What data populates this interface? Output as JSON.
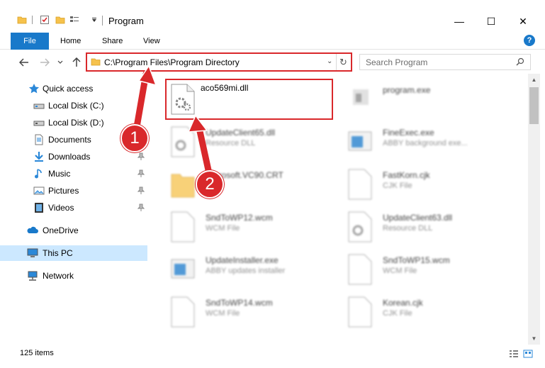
{
  "window": {
    "title": "Program",
    "minimize": "—",
    "maximize": "☐",
    "close": "✕"
  },
  "ribbon": {
    "tabs": [
      "File",
      "Home",
      "Share",
      "View"
    ],
    "help": "?"
  },
  "address": {
    "path": "C:\\Program Files\\Program Directory",
    "chevron": "⌄",
    "refresh": "↻"
  },
  "search": {
    "placeholder": "Search Program"
  },
  "sidebar": {
    "items": [
      {
        "label": "Quick access",
        "icon": "star-icon",
        "pinned": false
      },
      {
        "label": "Local Disk (C:)",
        "icon": "drive-icon",
        "pinned": false
      },
      {
        "label": "Local Disk (D:)",
        "icon": "drive-icon",
        "pinned": false
      },
      {
        "label": "Documents",
        "icon": "documents-icon",
        "pinned": true
      },
      {
        "label": "Downloads",
        "icon": "download-icon",
        "pinned": true
      },
      {
        "label": "Music",
        "icon": "music-icon",
        "pinned": true
      },
      {
        "label": "Pictures",
        "icon": "pictures-icon",
        "pinned": true
      },
      {
        "label": "Videos",
        "icon": "videos-icon",
        "pinned": true
      },
      {
        "label": "OneDrive",
        "icon": "cloud-icon",
        "pinned": false
      },
      {
        "label": "This PC",
        "icon": "computer-icon",
        "pinned": false
      },
      {
        "label": "Network",
        "icon": "network-icon",
        "pinned": false
      }
    ]
  },
  "files": [
    {
      "name": "aco569mi.dll",
      "desc": "",
      "type": "dll",
      "highlighted": true
    },
    {
      "name": "program.exe",
      "desc": "",
      "type": "exe"
    },
    {
      "name": "UpdateClient65.dll",
      "desc": "Resource DLL",
      "type": "dll"
    },
    {
      "name": "FineExec.exe",
      "desc": "ABBY background exe...",
      "type": "exe-blue"
    },
    {
      "name": "Microsoft.VC90.CRT",
      "desc": "",
      "type": "folder"
    },
    {
      "name": "FastKorn.cjk",
      "desc": "CJK File",
      "type": "doc"
    },
    {
      "name": "SndToWP12.wcm",
      "desc": "WCM File",
      "type": "doc"
    },
    {
      "name": "UpdateClient63.dll",
      "desc": "Resource DLL",
      "type": "dll"
    },
    {
      "name": "UpdateInstaller.exe",
      "desc": "ABBY updates installer",
      "type": "exe-blue"
    },
    {
      "name": "SndToWP15.wcm",
      "desc": "WCM File",
      "type": "doc"
    },
    {
      "name": "SndToWP14.wcm",
      "desc": "WCM File",
      "type": "doc"
    },
    {
      "name": "Korean.cjk",
      "desc": "CJK File",
      "type": "doc"
    }
  ],
  "annotations": [
    "1",
    "2"
  ],
  "status": {
    "count": "125 items"
  },
  "colors": {
    "accent": "#1979ca",
    "highlight": "#d9282b",
    "selected": "#cce8ff"
  }
}
